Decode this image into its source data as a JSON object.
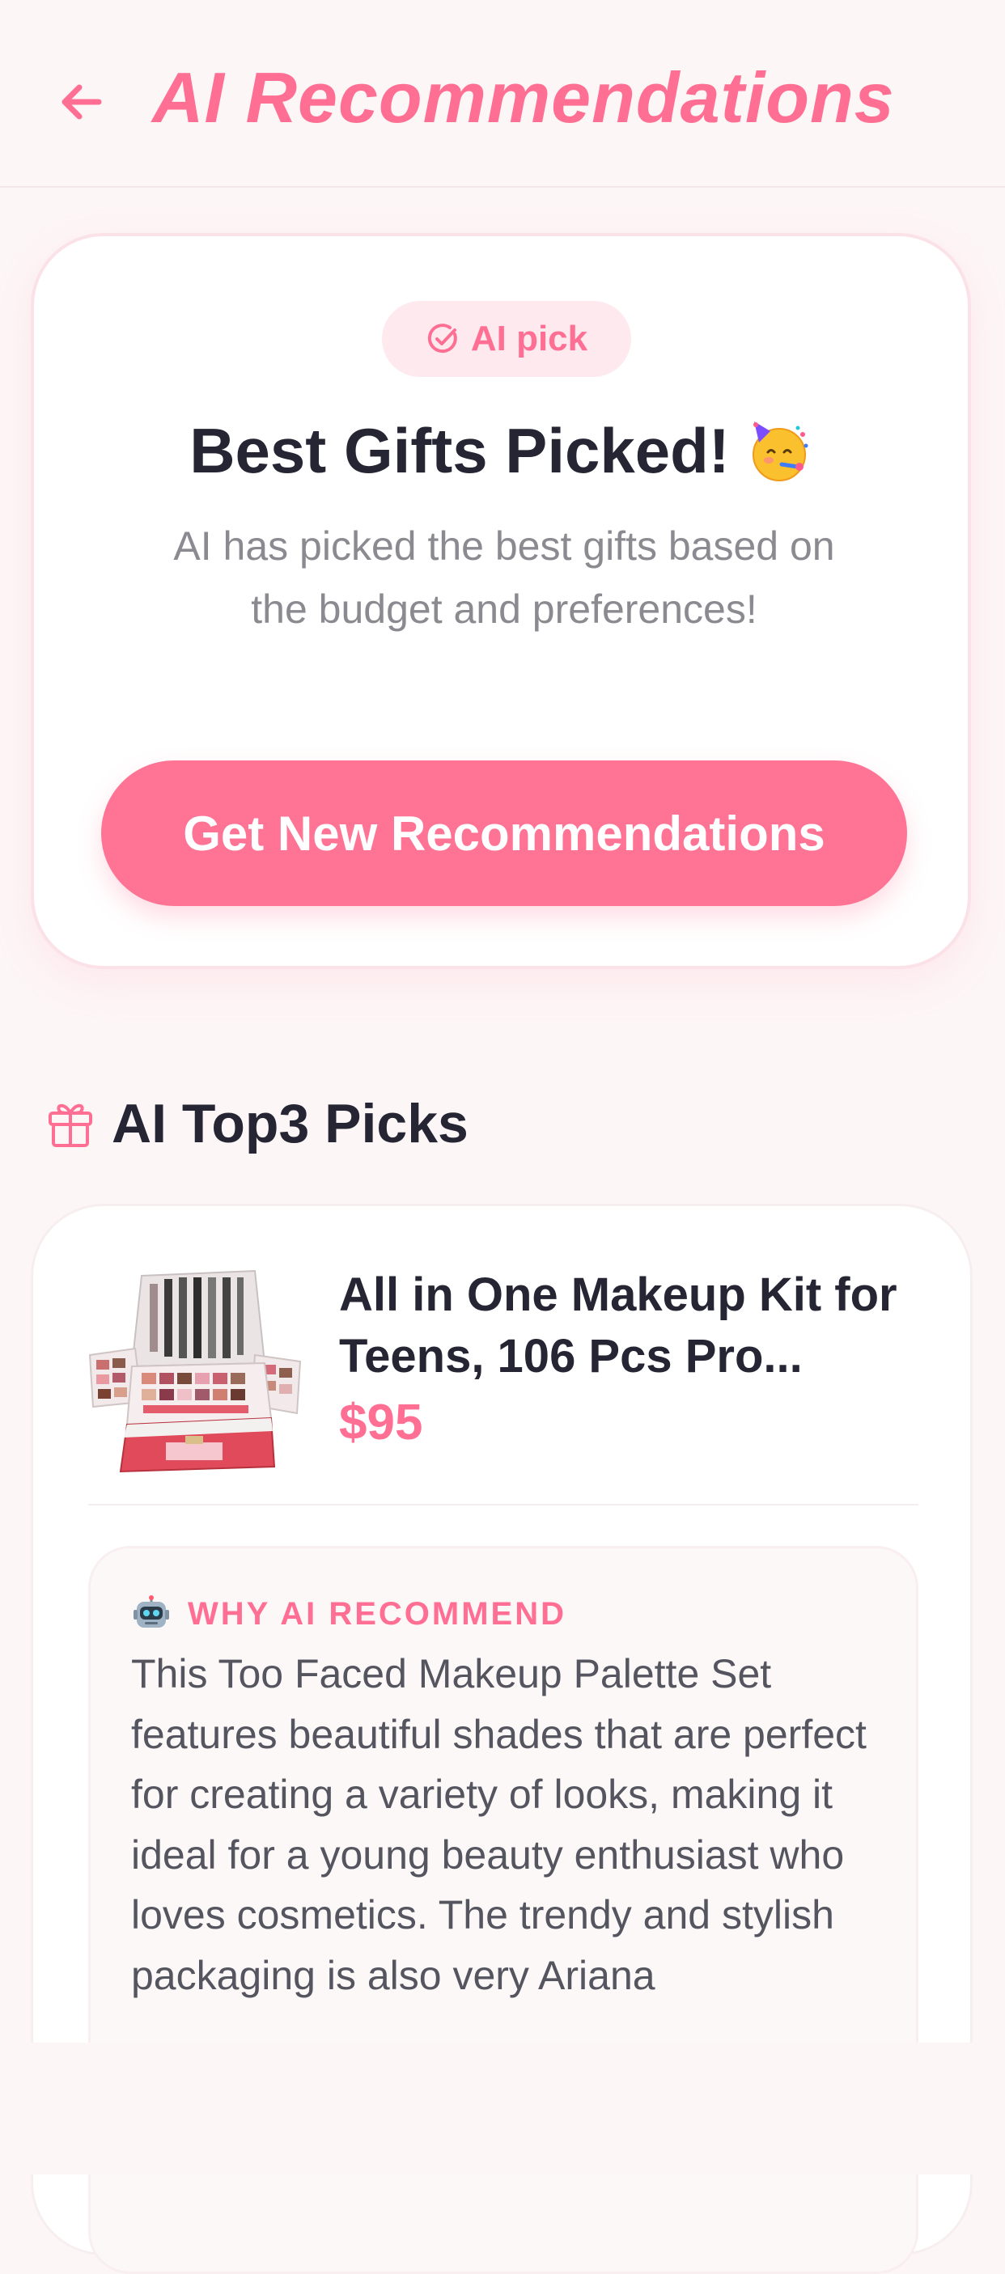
{
  "header": {
    "title": "AI Recommendations",
    "back_icon": "arrow-left-icon",
    "accent_color": "#ff6f93"
  },
  "hero": {
    "badge_icon": "check-circle-icon",
    "badge_label": "AI pick",
    "title": "Best Gifts Picked!",
    "title_emoji": "party-face-emoji",
    "description": "AI has picked the best gifts based on the budget and preferences!",
    "cta_label": "Get New Recommendations",
    "cta_color": "#ff7394"
  },
  "section": {
    "icon": "gift-icon",
    "title": "AI Top3 Picks"
  },
  "products": [
    {
      "image_icon": "makeup-kit-image",
      "name": "All in One Makeup Kit for Teens, 106 Pcs Pro...",
      "price": "$95",
      "why_icon": "robot-icon",
      "why_title": "WHY AI RECOMMEND",
      "why_text": "This Too Faced Makeup Palette Set features beautiful shades that are perfect for creating a variety of looks, making it ideal for a young beauty enthusiast who loves cosmetics. The trendy and stylish packaging is also very Ariana"
    }
  ]
}
